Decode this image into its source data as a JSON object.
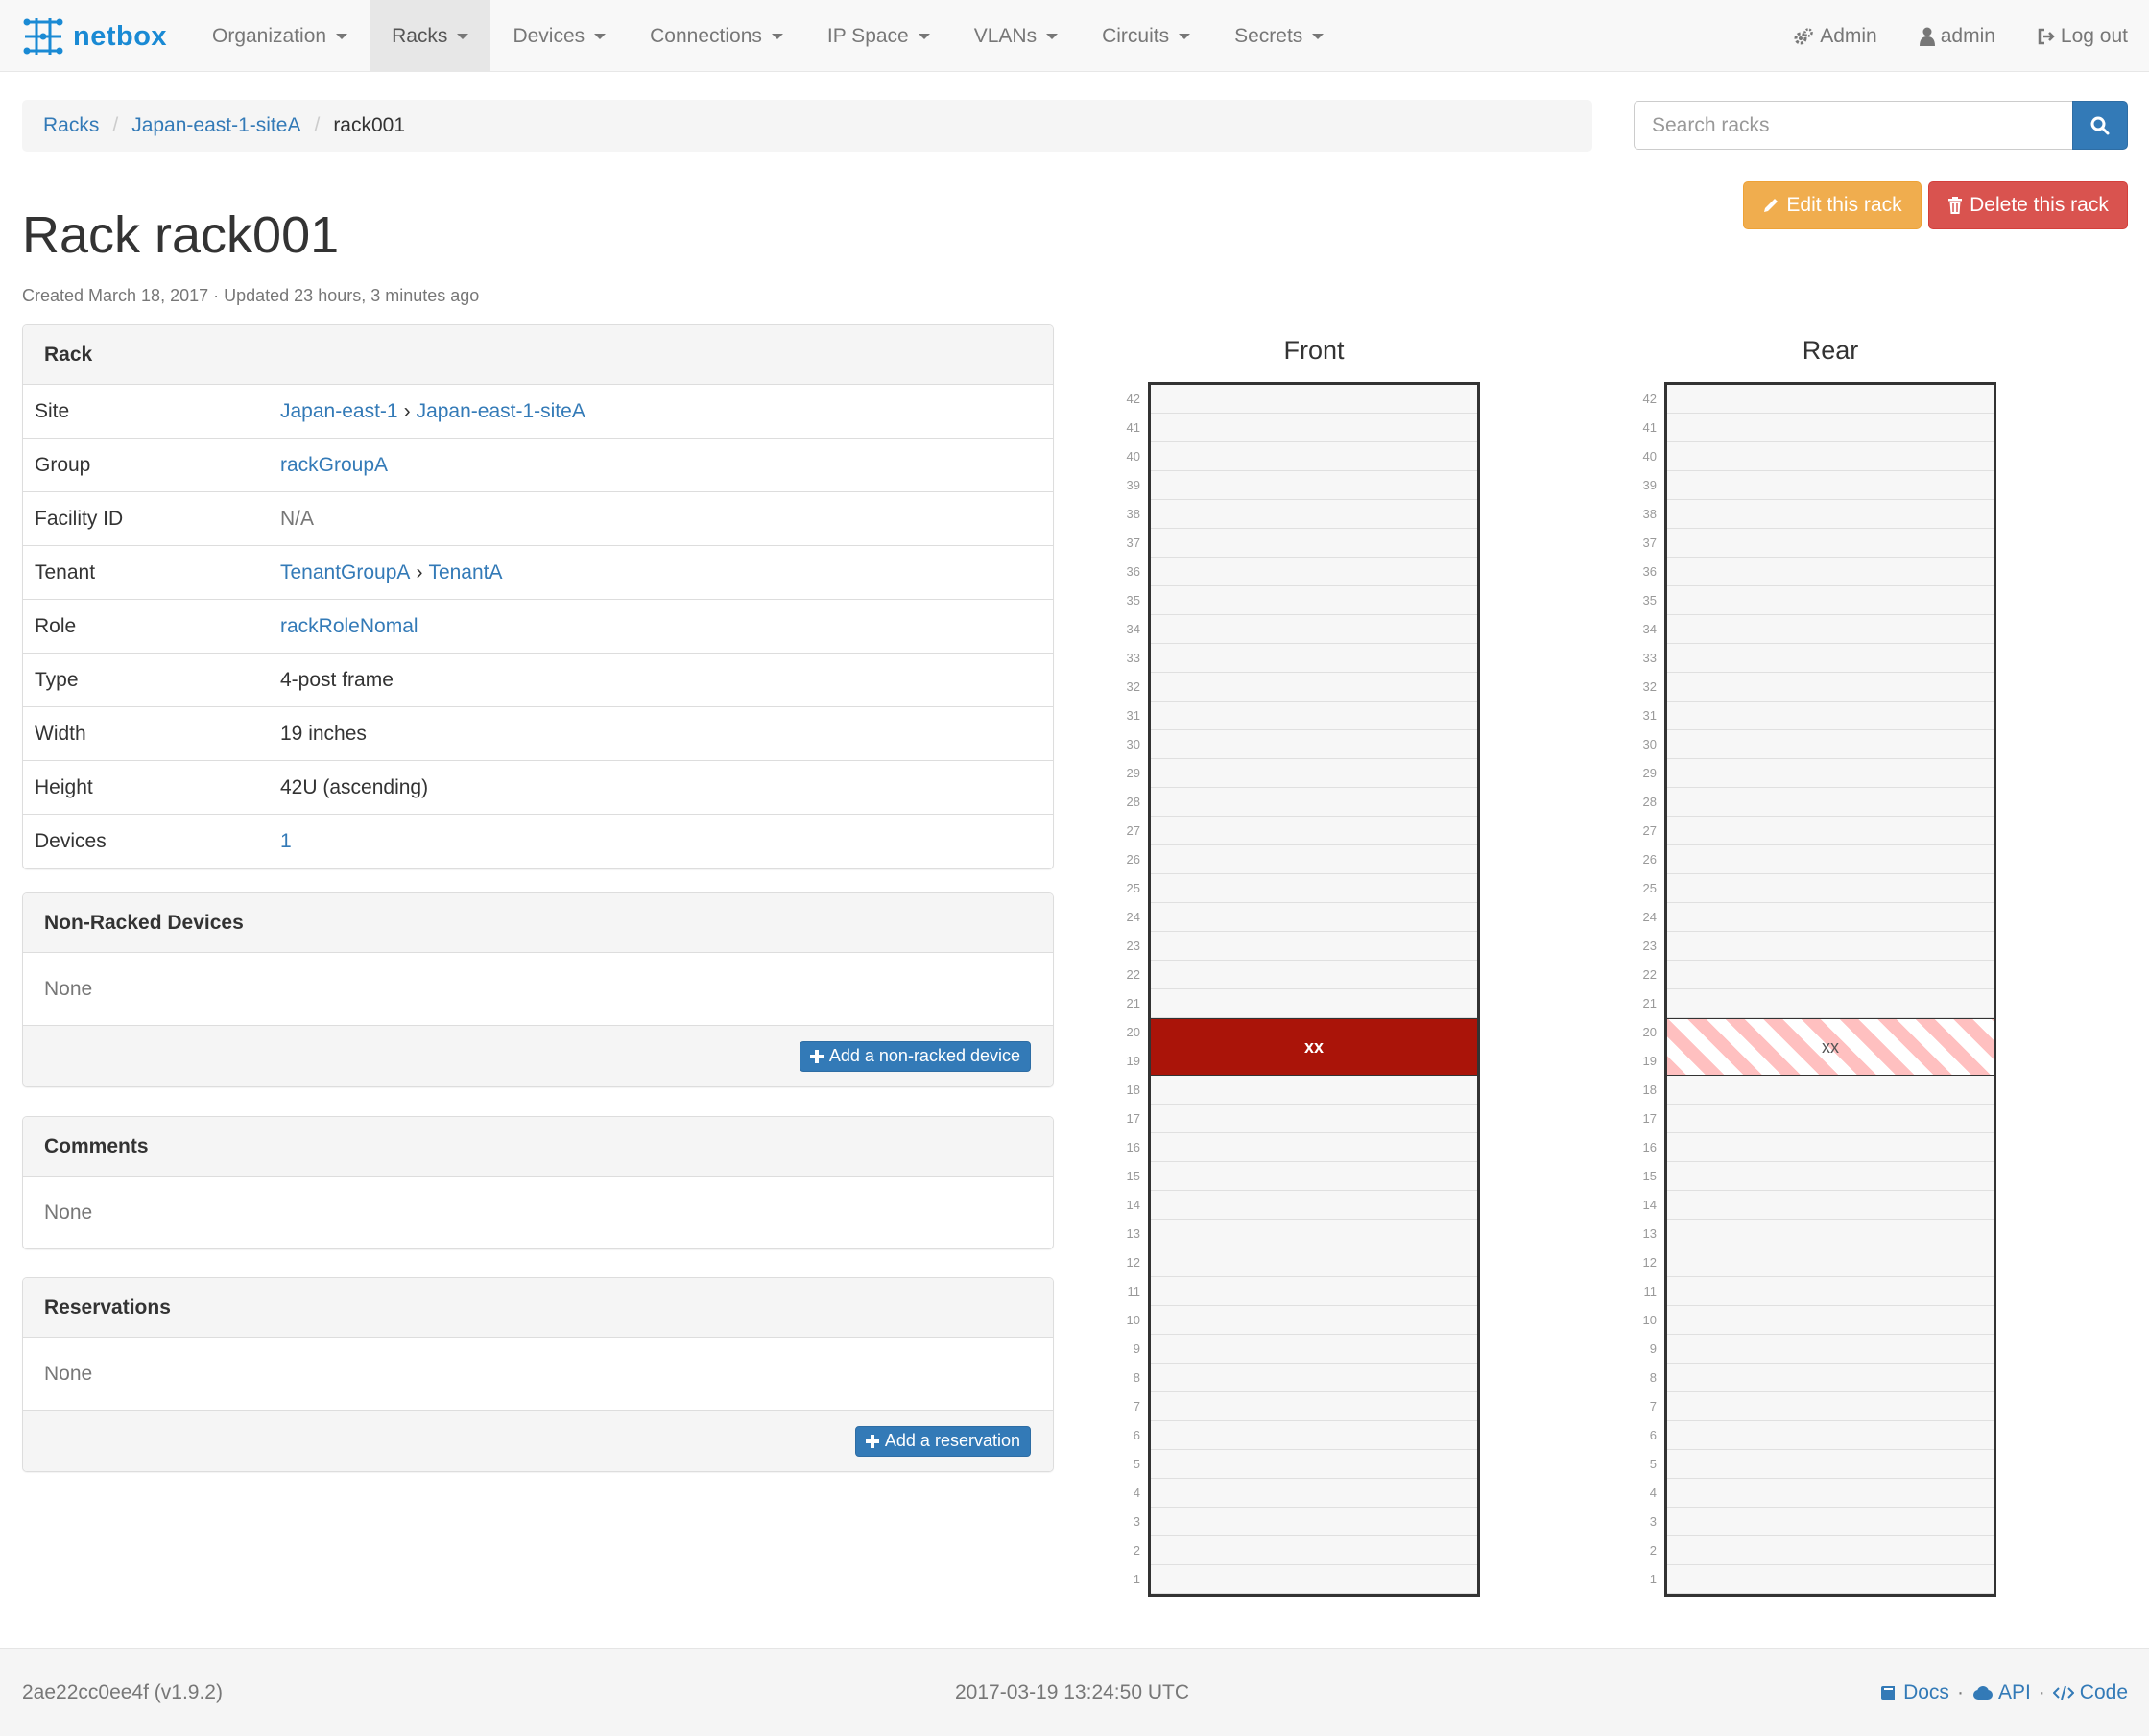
{
  "brand": {
    "name": "netbox"
  },
  "nav": {
    "items": [
      {
        "label": "Organization"
      },
      {
        "label": "Racks"
      },
      {
        "label": "Devices"
      },
      {
        "label": "Connections"
      },
      {
        "label": "IP Space"
      },
      {
        "label": "VLANs"
      },
      {
        "label": "Circuits"
      },
      {
        "label": "Secrets"
      }
    ],
    "right": {
      "admin_panel": "Admin",
      "user": "admin",
      "logout": "Log out"
    }
  },
  "breadcrumb": {
    "items": [
      "Racks",
      "Japan-east-1-siteA"
    ],
    "active": "rack001"
  },
  "search": {
    "placeholder": "Search racks"
  },
  "actions": {
    "edit": "Edit this rack",
    "delete": "Delete this rack"
  },
  "page": {
    "title": "Rack rack001",
    "meta": "Created March 18, 2017 · Updated 23 hours, 3 minutes ago"
  },
  "rack_panel": {
    "heading": "Rack",
    "rows": {
      "site": {
        "label": "Site",
        "region": "Japan-east-1",
        "site": "Japan-east-1-siteA"
      },
      "group": {
        "label": "Group",
        "value": "rackGroupA"
      },
      "facility": {
        "label": "Facility ID",
        "value": "N/A"
      },
      "tenant": {
        "label": "Tenant",
        "group": "TenantGroupA",
        "tenant": "TenantA"
      },
      "role": {
        "label": "Role",
        "value": "rackRoleNomal"
      },
      "type": {
        "label": "Type",
        "value": "4-post frame"
      },
      "width": {
        "label": "Width",
        "value": "19 inches"
      },
      "height": {
        "label": "Height",
        "value": "42U (ascending)"
      },
      "devices": {
        "label": "Devices",
        "value": "1"
      }
    }
  },
  "non_racked": {
    "heading": "Non-Racked Devices",
    "body": "None",
    "button": "Add a non-racked device"
  },
  "comments": {
    "heading": "Comments",
    "body": "None"
  },
  "reservations": {
    "heading": "Reservations",
    "body": "None",
    "button": "Add a reservation"
  },
  "elevation": {
    "total_units": 42,
    "front": {
      "title": "Front",
      "device": {
        "name": "xx",
        "units": [
          19,
          20
        ]
      }
    },
    "rear": {
      "title": "Rear",
      "device": {
        "name": "xx",
        "units": [
          19,
          20
        ]
      }
    },
    "colors": {
      "device_front": "#aa1409",
      "device_rear_stripe": "#ffc0c0"
    }
  },
  "footer": {
    "version": "2ae22cc0ee4f (v1.9.2)",
    "timestamp": "2017-03-19 13:24:50 UTC",
    "links": {
      "docs": "Docs",
      "api": "API",
      "code": "Code"
    }
  }
}
